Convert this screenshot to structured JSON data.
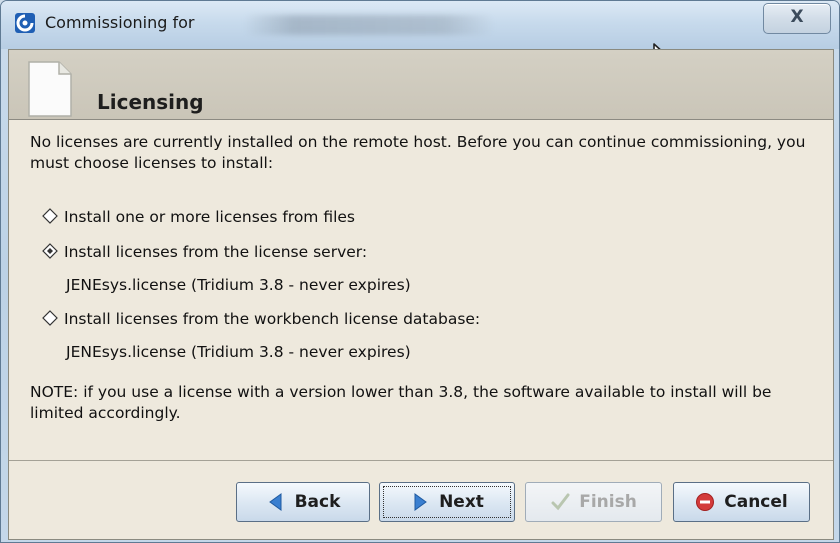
{
  "window": {
    "title": "Commissioning for",
    "close_label": "X"
  },
  "header": {
    "title": "Licensing"
  },
  "body": {
    "intro": "No licenses are currently installed on the remote host. Before you can continue commissioning, you must choose licenses to install:",
    "options": [
      {
        "label": "Install one or more licenses from files",
        "selected": false
      },
      {
        "label": "Install licenses from the license server:",
        "selected": true,
        "detail": "JENEsys.license (Tridium 3.8 - never expires)"
      },
      {
        "label": "Install licenses from the workbench license database:",
        "selected": false,
        "detail": "JENEsys.license (Tridium 3.8 - never expires)"
      }
    ],
    "note": "NOTE: if you use a license with a version lower than 3.8, the software available to install will be limited accordingly."
  },
  "buttons": {
    "back": "Back",
    "next": "Next",
    "finish": "Finish",
    "cancel": "Cancel"
  },
  "icons": {
    "app": "niagara-app-icon",
    "header": "document-icon",
    "back": "left-arrow-icon",
    "next": "right-arrow-icon",
    "finish": "checkmark-icon",
    "cancel": "cancel-icon"
  },
  "colors": {
    "accent": "#3a7fd0",
    "cancel": "#d33b3b"
  }
}
